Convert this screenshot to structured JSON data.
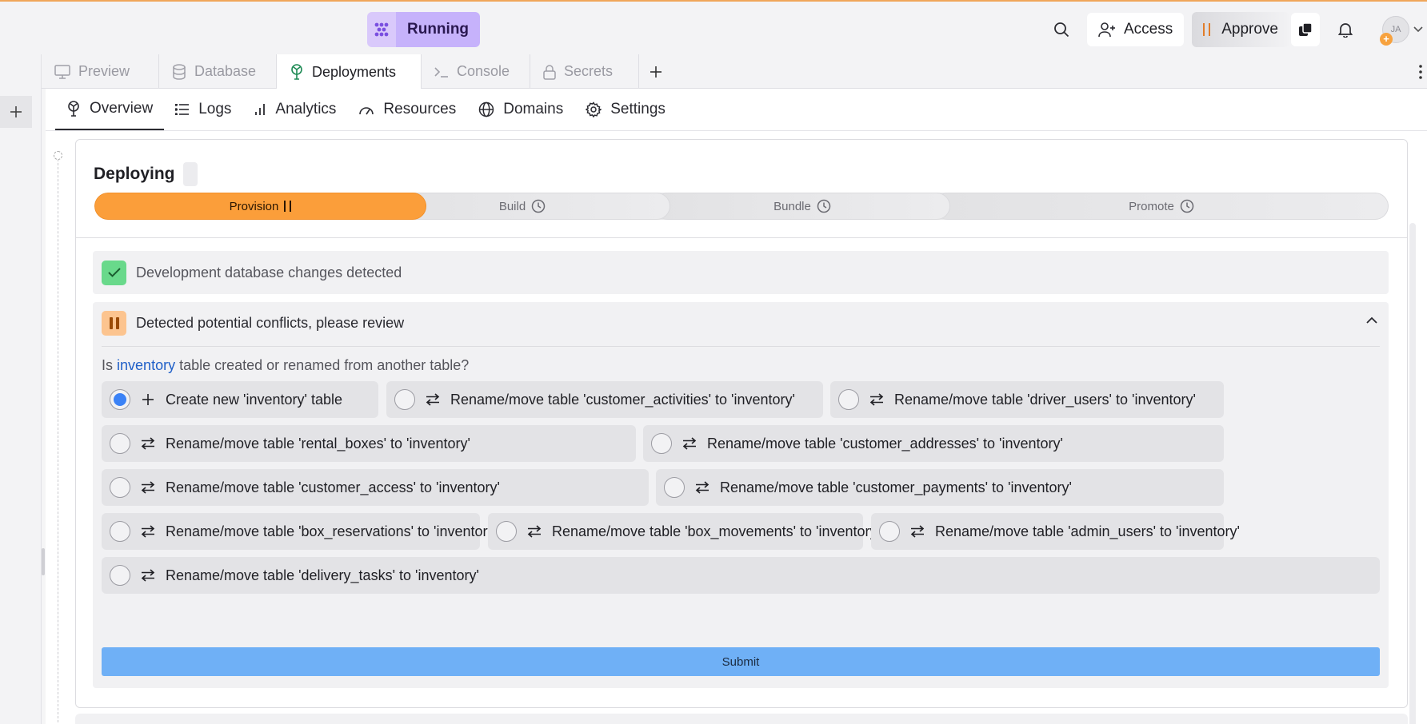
{
  "topbar": {
    "run_label": "Running",
    "access_label": "Access",
    "approve_label": "Approve",
    "avatar_initials": "JA"
  },
  "file_tabs": [
    {
      "label": "Preview"
    },
    {
      "label": "Database"
    },
    {
      "label": "Deployments"
    },
    {
      "label": "Console"
    },
    {
      "label": "Secrets"
    }
  ],
  "subnav": [
    {
      "label": "Overview"
    },
    {
      "label": "Logs"
    },
    {
      "label": "Analytics"
    },
    {
      "label": "Resources"
    },
    {
      "label": "Domains"
    },
    {
      "label": "Settings"
    }
  ],
  "deploy": {
    "title": "Deploying",
    "steps": [
      {
        "label": "Provision",
        "status": "paused"
      },
      {
        "label": "Build",
        "status": "pending"
      },
      {
        "label": "Bundle",
        "status": "pending"
      },
      {
        "label": "Promote",
        "status": "pending"
      }
    ],
    "changes_banner": "Development database changes detected",
    "conflicts_title": "Detected potential conflicts, please review",
    "question": {
      "prefix": "Is",
      "table": "inventory",
      "suffix": "table created or renamed from another table?"
    },
    "options": [
      {
        "label": "Create new 'inventory' table",
        "icon": "plus-icon",
        "selected": true
      },
      {
        "label": "Rename/move table 'customer_activities' to 'inventory'",
        "icon": "swap-icon",
        "selected": false
      },
      {
        "label": "Rename/move table 'driver_users' to 'inventory'",
        "icon": "swap-icon",
        "selected": false
      },
      {
        "label": "Rename/move table 'rental_boxes' to 'inventory'",
        "icon": "swap-icon",
        "selected": false
      },
      {
        "label": "Rename/move table 'customer_addresses' to 'inventory'",
        "icon": "swap-icon",
        "selected": false
      },
      {
        "label": "Rename/move table 'customer_access' to 'inventory'",
        "icon": "swap-icon",
        "selected": false
      },
      {
        "label": "Rename/move table 'customer_payments' to 'inventory'",
        "icon": "swap-icon",
        "selected": false
      },
      {
        "label": "Rename/move table 'box_reservations' to 'inventory'",
        "icon": "swap-icon",
        "selected": false
      },
      {
        "label": "Rename/move table 'box_movements' to 'inventory'",
        "icon": "swap-icon",
        "selected": false
      },
      {
        "label": "Rename/move table 'admin_users' to 'inventory'",
        "icon": "swap-icon",
        "selected": false
      },
      {
        "label": "Rename/move table 'delivery_tasks' to 'inventory'",
        "icon": "swap-icon",
        "selected": false
      }
    ],
    "submit_label": "Submit"
  },
  "colors": {
    "accent_running": "#c6b2fb",
    "step_active": "#fb9e3a",
    "submit": "#6fb0f6",
    "success": "#69d98b",
    "radio_selected": "#3b82f6"
  }
}
